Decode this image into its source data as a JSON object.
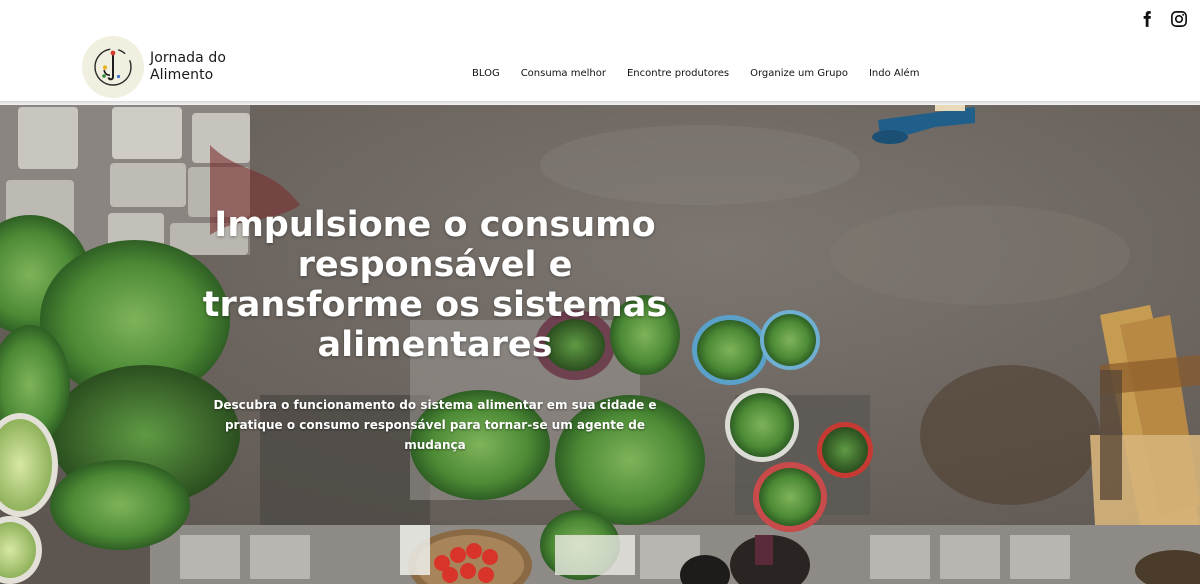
{
  "brand": {
    "name_line1": "Jornada do",
    "name_line2": "Alimento"
  },
  "social": {
    "facebook_icon": "facebook-icon",
    "instagram_icon": "instagram-icon"
  },
  "nav": {
    "items": [
      {
        "label": "BLOG"
      },
      {
        "label": "Consuma melhor"
      },
      {
        "label": "Encontre produtores"
      },
      {
        "label": "Organize um Grupo"
      },
      {
        "label": "Indo Além"
      }
    ]
  },
  "hero": {
    "title": "Impulsione o consumo responsável e transforme os sistemas alimentares",
    "subtitle": "Descubra o funcionamento do sistema alimentar em sua cidade e pratique o consumo responsável para tornar-se um agente de mudança"
  },
  "colors": {
    "header_bg": "#ffffff",
    "logo_badge_bg": "#f1efdf",
    "hero_text": "#ffffff"
  }
}
